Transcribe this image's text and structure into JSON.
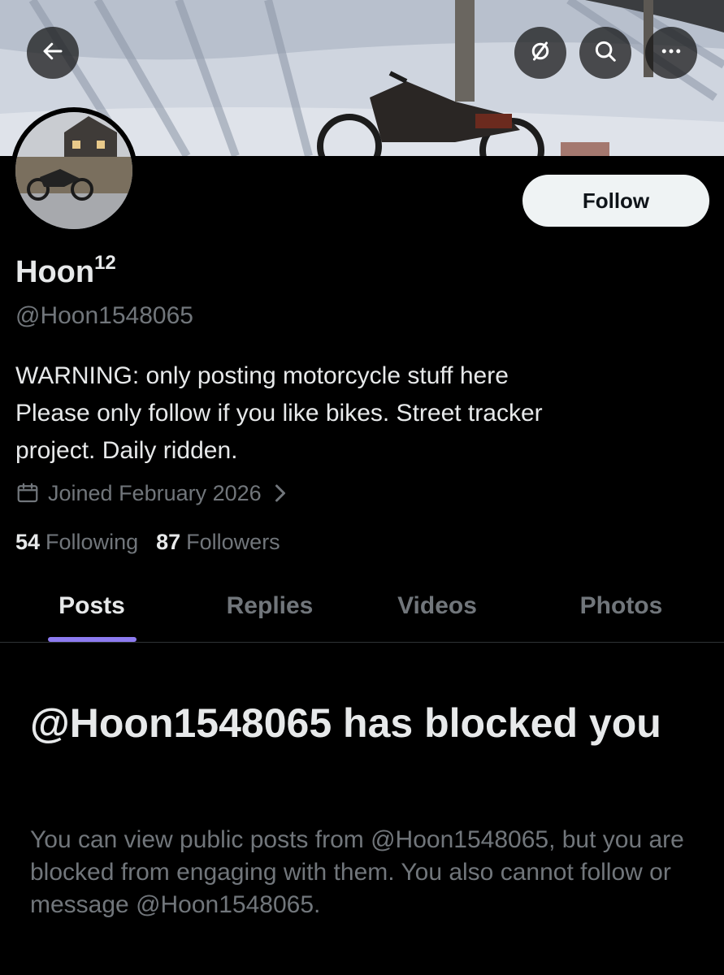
{
  "header": {
    "back_icon": "arrow-left-icon",
    "sync_icon": "circle-slash-icon",
    "search_icon": "search-icon",
    "more_icon": "more-horizontal-icon"
  },
  "profile": {
    "display_name": "Hoon",
    "name_superscript": "12",
    "handle": "@Hoon1548065",
    "follow_label": "Follow",
    "bio_lines": [
      "WARNING: only posting motorcycle stuff here",
      "Please only follow if you like bikes. Street tracker",
      "project. Daily ridden."
    ],
    "joined": "Joined February 2026",
    "following_count": "54",
    "following_label": "Following",
    "followers_count": "87",
    "followers_label": "Followers"
  },
  "tabs": [
    {
      "label": "Posts",
      "active": true
    },
    {
      "label": "Replies",
      "active": false
    },
    {
      "label": "Videos",
      "active": false
    },
    {
      "label": "Photos",
      "active": false
    }
  ],
  "blocked": {
    "title": "@Hoon1548065 has blocked you",
    "description": "You can view public posts from @Hoon1548065, but you are blocked from engaging with them. You also cannot follow or message @Hoon1548065."
  },
  "colors": {
    "background": "#000000",
    "primary_text": "#e7e9ea",
    "secondary_text": "#71767b",
    "tab_indicator": "#8d7bf0",
    "follow_button_bg": "#eff3f4"
  }
}
